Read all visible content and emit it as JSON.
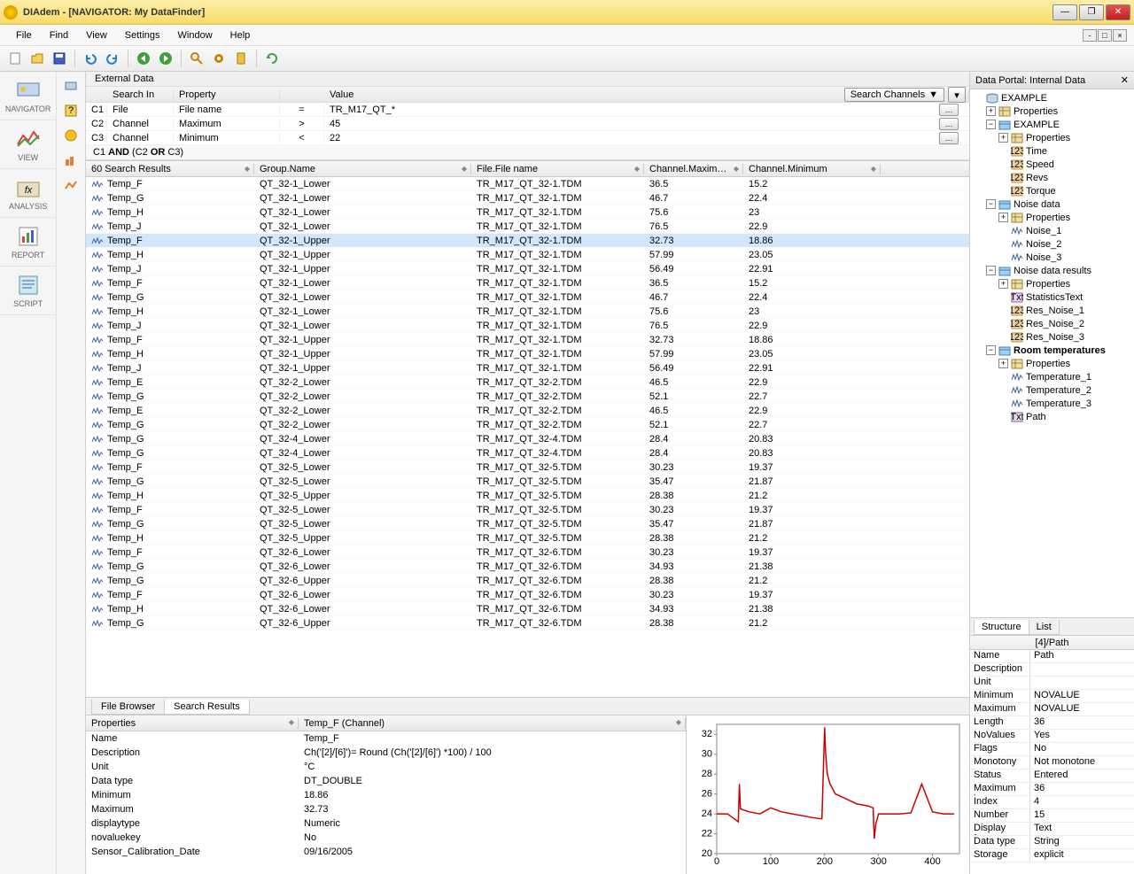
{
  "window": {
    "title": "DIAdem - [NAVIGATOR:  My DataFinder]"
  },
  "menu": [
    "File",
    "Find",
    "View",
    "Settings",
    "Window",
    "Help"
  ],
  "left_nav": [
    {
      "label": "NAVIGATOR"
    },
    {
      "label": "VIEW"
    },
    {
      "label": "ANALYSIS"
    },
    {
      "label": "REPORT"
    },
    {
      "label": "SCRIPT"
    }
  ],
  "external_data_label": "External Data",
  "search": {
    "headers": [
      "",
      "Search In",
      "Property",
      "",
      "Value"
    ],
    "rows": [
      {
        "id": "C1",
        "searchIn": "File",
        "property": "File name",
        "op": "=",
        "value": "TR_M17_QT_*"
      },
      {
        "id": "C2",
        "searchIn": "Channel",
        "property": "Maximum",
        "op": ">",
        "value": "45"
      },
      {
        "id": "C3",
        "searchIn": "Channel",
        "property": "Minimum",
        "op": "<",
        "value": "22"
      }
    ],
    "logic": "C1 AND (C2 OR C3)",
    "dropdown": "Search Channels"
  },
  "results": {
    "count_label": "60 Search Results",
    "headers": [
      "Group.Name",
      "File.File name",
      "Channel.Maxim…",
      "Channel.Minimum"
    ],
    "selected_index": 4,
    "rows": [
      {
        "name": "Temp_F",
        "group": "QT_32-1_Lower",
        "file": "TR_M17_QT_32-1.TDM",
        "max": "36.5",
        "min": "15.2"
      },
      {
        "name": "Temp_G",
        "group": "QT_32-1_Lower",
        "file": "TR_M17_QT_32-1.TDM",
        "max": "46.7",
        "min": "22.4"
      },
      {
        "name": "Temp_H",
        "group": "QT_32-1_Lower",
        "file": "TR_M17_QT_32-1.TDM",
        "max": "75.6",
        "min": "23"
      },
      {
        "name": "Temp_J",
        "group": "QT_32-1_Lower",
        "file": "TR_M17_QT_32-1.TDM",
        "max": "76.5",
        "min": "22.9"
      },
      {
        "name": "Temp_F",
        "group": "QT_32-1_Upper",
        "file": "TR_M17_QT_32-1.TDM",
        "max": "32.73",
        "min": "18.86"
      },
      {
        "name": "Temp_H",
        "group": "QT_32-1_Upper",
        "file": "TR_M17_QT_32-1.TDM",
        "max": "57.99",
        "min": "23.05"
      },
      {
        "name": "Temp_J",
        "group": "QT_32-1_Upper",
        "file": "TR_M17_QT_32-1.TDM",
        "max": "56.49",
        "min": "22.91"
      },
      {
        "name": "Temp_F",
        "group": "QT_32-1_Lower",
        "file": "TR_M17_QT_32-1.TDM",
        "max": "36.5",
        "min": "15.2"
      },
      {
        "name": "Temp_G",
        "group": "QT_32-1_Lower",
        "file": "TR_M17_QT_32-1.TDM",
        "max": "46.7",
        "min": "22.4"
      },
      {
        "name": "Temp_H",
        "group": "QT_32-1_Lower",
        "file": "TR_M17_QT_32-1.TDM",
        "max": "75.6",
        "min": "23"
      },
      {
        "name": "Temp_J",
        "group": "QT_32-1_Lower",
        "file": "TR_M17_QT_32-1.TDM",
        "max": "76.5",
        "min": "22.9"
      },
      {
        "name": "Temp_F",
        "group": "QT_32-1_Upper",
        "file": "TR_M17_QT_32-1.TDM",
        "max": "32.73",
        "min": "18.86"
      },
      {
        "name": "Temp_H",
        "group": "QT_32-1_Upper",
        "file": "TR_M17_QT_32-1.TDM",
        "max": "57.99",
        "min": "23.05"
      },
      {
        "name": "Temp_J",
        "group": "QT_32-1_Upper",
        "file": "TR_M17_QT_32-1.TDM",
        "max": "56.49",
        "min": "22.91"
      },
      {
        "name": "Temp_E",
        "group": "QT_32-2_Lower",
        "file": "TR_M17_QT_32-2.TDM",
        "max": "46.5",
        "min": "22.9"
      },
      {
        "name": "Temp_G",
        "group": "QT_32-2_Lower",
        "file": "TR_M17_QT_32-2.TDM",
        "max": "52.1",
        "min": "22.7"
      },
      {
        "name": "Temp_E",
        "group": "QT_32-2_Lower",
        "file": "TR_M17_QT_32-2.TDM",
        "max": "46.5",
        "min": "22.9"
      },
      {
        "name": "Temp_G",
        "group": "QT_32-2_Lower",
        "file": "TR_M17_QT_32-2.TDM",
        "max": "52.1",
        "min": "22.7"
      },
      {
        "name": "Temp_G",
        "group": "QT_32-4_Lower",
        "file": "TR_M17_QT_32-4.TDM",
        "max": "28.4",
        "min": "20.83"
      },
      {
        "name": "Temp_G",
        "group": "QT_32-4_Lower",
        "file": "TR_M17_QT_32-4.TDM",
        "max": "28.4",
        "min": "20.83"
      },
      {
        "name": "Temp_F",
        "group": "QT_32-5_Lower",
        "file": "TR_M17_QT_32-5.TDM",
        "max": "30.23",
        "min": "19.37"
      },
      {
        "name": "Temp_G",
        "group": "QT_32-5_Lower",
        "file": "TR_M17_QT_32-5.TDM",
        "max": "35.47",
        "min": "21.87"
      },
      {
        "name": "Temp_H",
        "group": "QT_32-5_Upper",
        "file": "TR_M17_QT_32-5.TDM",
        "max": "28.38",
        "min": "21.2"
      },
      {
        "name": "Temp_F",
        "group": "QT_32-5_Lower",
        "file": "TR_M17_QT_32-5.TDM",
        "max": "30.23",
        "min": "19.37"
      },
      {
        "name": "Temp_G",
        "group": "QT_32-5_Lower",
        "file": "TR_M17_QT_32-5.TDM",
        "max": "35.47",
        "min": "21.87"
      },
      {
        "name": "Temp_H",
        "group": "QT_32-5_Upper",
        "file": "TR_M17_QT_32-5.TDM",
        "max": "28.38",
        "min": "21.2"
      },
      {
        "name": "Temp_F",
        "group": "QT_32-6_Lower",
        "file": "TR_M17_QT_32-6.TDM",
        "max": "30.23",
        "min": "19.37"
      },
      {
        "name": "Temp_G",
        "group": "QT_32-6_Lower",
        "file": "TR_M17_QT_32-6.TDM",
        "max": "34.93",
        "min": "21.38"
      },
      {
        "name": "Temp_G",
        "group": "QT_32-6_Upper",
        "file": "TR_M17_QT_32-6.TDM",
        "max": "28.38",
        "min": "21.2"
      },
      {
        "name": "Temp_F",
        "group": "QT_32-6_Lower",
        "file": "TR_M17_QT_32-6.TDM",
        "max": "30.23",
        "min": "19.37"
      },
      {
        "name": "Temp_H",
        "group": "QT_32-6_Lower",
        "file": "TR_M17_QT_32-6.TDM",
        "max": "34.93",
        "min": "21.38"
      },
      {
        "name": "Temp_G",
        "group": "QT_32-6_Upper",
        "file": "TR_M17_QT_32-6.TDM",
        "max": "28.38",
        "min": "21.2"
      }
    ]
  },
  "bottom_tabs": [
    "File Browser",
    "Search Results"
  ],
  "properties": {
    "header_label": "Properties",
    "channel_label": "Temp_F (Channel)",
    "rows": [
      {
        "k": "Name",
        "v": "Temp_F"
      },
      {
        "k": "Description",
        "v": "Ch('[2]/[6]')= Round (Ch('[2]/[6]') *100) / 100"
      },
      {
        "k": "Unit",
        "v": "°C"
      },
      {
        "k": "Data type",
        "v": "DT_DOUBLE"
      },
      {
        "k": "Minimum",
        "v": "18.86"
      },
      {
        "k": "Maximum",
        "v": "32.73"
      },
      {
        "k": "displaytype",
        "v": "Numeric"
      },
      {
        "k": "novaluekey",
        "v": "No"
      },
      {
        "k": "Sensor_Calibration_Date",
        "v": "09/16/2005"
      }
    ]
  },
  "chart_data": {
    "type": "line",
    "xlabel": "",
    "ylabel": "",
    "xlim": [
      0,
      450
    ],
    "ylim": [
      20,
      33
    ],
    "yticks": [
      20,
      22,
      24,
      26,
      28,
      30,
      32
    ],
    "xticks": [
      0,
      100,
      200,
      300,
      400
    ],
    "series": [
      {
        "name": "Temp_F",
        "color": "#cc0000",
        "x": [
          0,
          20,
          40,
          42,
          44,
          60,
          80,
          100,
          120,
          140,
          160,
          180,
          195,
          198,
          200,
          202,
          205,
          210,
          220,
          240,
          260,
          280,
          290,
          292,
          295,
          300,
          320,
          340,
          360,
          380,
          400,
          420,
          440
        ],
        "y": [
          24,
          24,
          23.2,
          27,
          24.5,
          24.2,
          24,
          24.6,
          24.2,
          24,
          23.8,
          23.6,
          23.5,
          29,
          32.7,
          30,
          28,
          27,
          26,
          25.5,
          25,
          24.8,
          24.6,
          21.5,
          23,
          24,
          24,
          24,
          24.1,
          27,
          24.2,
          24,
          24
        ]
      }
    ]
  },
  "portal": {
    "title": "Data Portal: Internal Data",
    "tree": [
      {
        "depth": 0,
        "expand": "",
        "icon": "db",
        "label": "EXAMPLE"
      },
      {
        "depth": 1,
        "expand": "+",
        "icon": "grid",
        "label": "Properties"
      },
      {
        "depth": 1,
        "expand": "-",
        "icon": "group",
        "label": "EXAMPLE"
      },
      {
        "depth": 2,
        "expand": "+",
        "icon": "grid",
        "label": "Properties"
      },
      {
        "depth": 2,
        "expand": "",
        "icon": "num",
        "label": "Time"
      },
      {
        "depth": 2,
        "expand": "",
        "icon": "num",
        "label": "Speed"
      },
      {
        "depth": 2,
        "expand": "",
        "icon": "num",
        "label": "Revs"
      },
      {
        "depth": 2,
        "expand": "",
        "icon": "num",
        "label": "Torque"
      },
      {
        "depth": 1,
        "expand": "-",
        "icon": "group",
        "label": "Noise data"
      },
      {
        "depth": 2,
        "expand": "+",
        "icon": "grid",
        "label": "Properties"
      },
      {
        "depth": 2,
        "expand": "",
        "icon": "wave",
        "label": "Noise_1"
      },
      {
        "depth": 2,
        "expand": "",
        "icon": "wave",
        "label": "Noise_2"
      },
      {
        "depth": 2,
        "expand": "",
        "icon": "wave",
        "label": "Noise_3"
      },
      {
        "depth": 1,
        "expand": "-",
        "icon": "group",
        "label": "Noise data results"
      },
      {
        "depth": 2,
        "expand": "+",
        "icon": "grid",
        "label": "Properties"
      },
      {
        "depth": 2,
        "expand": "",
        "icon": "txt",
        "label": "StatisticsText"
      },
      {
        "depth": 2,
        "expand": "",
        "icon": "num",
        "label": "Res_Noise_1"
      },
      {
        "depth": 2,
        "expand": "",
        "icon": "num",
        "label": "Res_Noise_2"
      },
      {
        "depth": 2,
        "expand": "",
        "icon": "num",
        "label": "Res_Noise_3"
      },
      {
        "depth": 1,
        "expand": "-",
        "icon": "group",
        "label": "Room temperatures",
        "bold": true
      },
      {
        "depth": 2,
        "expand": "+",
        "icon": "grid",
        "label": "Properties"
      },
      {
        "depth": 2,
        "expand": "",
        "icon": "wave",
        "label": "Temperature_1"
      },
      {
        "depth": 2,
        "expand": "",
        "icon": "wave",
        "label": "Temperature_2"
      },
      {
        "depth": 2,
        "expand": "",
        "icon": "wave",
        "label": "Temperature_3"
      },
      {
        "depth": 2,
        "expand": "",
        "icon": "txt",
        "label": "Path"
      }
    ],
    "tabs": [
      "Structure",
      "List"
    ]
  },
  "detail": {
    "header": "[4]/Path",
    "rows": [
      {
        "k": "Name",
        "v": "Path"
      },
      {
        "k": "Description",
        "v": ""
      },
      {
        "k": "Unit",
        "v": ""
      },
      {
        "k": "Minimum",
        "v": "NOVALUE"
      },
      {
        "k": "Maximum",
        "v": "NOVALUE"
      },
      {
        "k": "Length",
        "v": "36"
      },
      {
        "k": "NoValues",
        "v": "Yes"
      },
      {
        "k": "Flags",
        "v": "No"
      },
      {
        "k": "Monotony",
        "v": "Not monotone"
      },
      {
        "k": "Status",
        "v": "Entered"
      },
      {
        "k": "Maximum l…",
        "v": "36"
      },
      {
        "k": "Index",
        "v": "4"
      },
      {
        "k": "Number",
        "v": "15"
      },
      {
        "k": "Display for…",
        "v": "Text"
      },
      {
        "k": "Data type",
        "v": "String"
      },
      {
        "k": "Storage",
        "v": "explicit"
      }
    ]
  }
}
